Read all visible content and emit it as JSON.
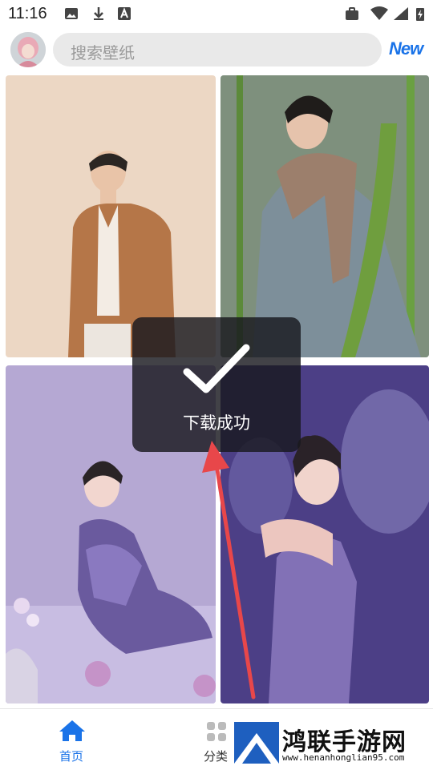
{
  "status": {
    "time": "11:16"
  },
  "search": {
    "placeholder": "搜索壁纸"
  },
  "header": {
    "badge": "New"
  },
  "toast": {
    "message": "下载成功"
  },
  "nav": {
    "items": [
      {
        "label": "首页",
        "active": true
      },
      {
        "label": "分类",
        "active": false
      }
    ]
  },
  "watermark": {
    "title": "鸿联手游网",
    "url": "www.henanhonglian95.com"
  },
  "colors": {
    "accent": "#1a73e8",
    "arrow": "#e8474a"
  }
}
